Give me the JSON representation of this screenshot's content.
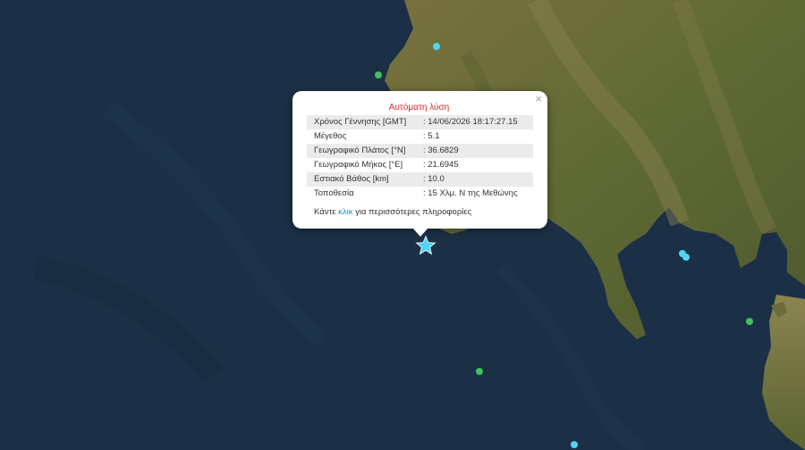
{
  "popup": {
    "heading": "Αυτόματη λύση",
    "close_glyph": "×",
    "rows": [
      {
        "label": "Χρόνος Γέννησης [GMT]",
        "value": ": 14/06/2026 18:17:27.15"
      },
      {
        "label": "Μέγεθος",
        "value": ": 5.1"
      },
      {
        "label": "Γεωγραφικό Πλάτος [°N]",
        "value": ": 36.6829"
      },
      {
        "label": "Γεωγραφικό Μήκος [°E]",
        "value": ": 21.6945"
      },
      {
        "label": "Εστιακό Βάθος [km]",
        "value": ": 10.0"
      },
      {
        "label": "Τοποθεσία",
        "value": ": 15 Χλμ. Ν της Μεθώνης"
      }
    ],
    "more_prefix": "Κάντε ",
    "more_link": "κλικ",
    "more_suffix": " για περισσότερες πληροφορίες"
  },
  "markers": {
    "epicenter_icon": "star-icon",
    "epicenter_color": "#4fd6f0",
    "quake_dots": [
      {
        "color": "#4fd6f0"
      },
      {
        "color": "#3fbf5f"
      },
      {
        "color": "#4fd6f0"
      },
      {
        "color": "#4fd6f0"
      },
      {
        "color": "#3fbf5f"
      },
      {
        "color": "#3fbf5f"
      },
      {
        "color": "#4fd6f0"
      }
    ]
  },
  "colors": {
    "sea": "#1a2f45",
    "land": "#6b6a38",
    "popup_heading": "#d62a2a",
    "link": "#1a8ed6"
  }
}
